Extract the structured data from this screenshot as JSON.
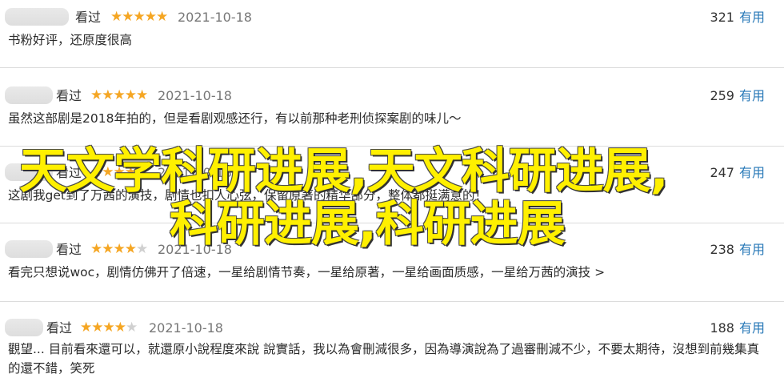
{
  "reviews": [
    {
      "status": "看过",
      "rating": 5,
      "date": "2021-10-18",
      "votes": "321",
      "useful_label": "有用",
      "text": "书粉好评，还原度很高"
    },
    {
      "status": "看过",
      "rating": 5,
      "date": "2021-10-18",
      "votes": "259",
      "useful_label": "有用",
      "text": "虽然这部剧是2018年拍的，但是看剧观感还行，有以前那种老刑侦探案剧的味儿～"
    },
    {
      "status": "看过",
      "rating": 4,
      "date": "2021-10-18",
      "votes": "247",
      "useful_label": "有用",
      "text": "这剧我get到了万茜的演技，剧情也扣人心弦，保留原著的精华部分，整体都挺满意的！"
    },
    {
      "status": "看过",
      "rating": 4,
      "date": "2021-10-18",
      "votes": "238",
      "useful_label": "有用",
      "text": "看完只想说woc，剧情仿佛开了倍速，一星给剧情节奏，一星给原著，一星给画面质感，一星给万茜的演技 >"
    },
    {
      "status": "看过",
      "rating": 4,
      "date": "2021-10-18",
      "votes": "188",
      "useful_label": "有用",
      "text": "觀望... 目前看來還可以，就還原小說程度來說 說實話，我以為會刪減很多，因為導演說為了過審刪減不少，不要太期待，沒想到前幾集真的還不錯，笑死"
    }
  ],
  "overlay": {
    "line1": "天文学科研进展,天文科研进展,",
    "line2": "科研进展,科研进展"
  },
  "colors": {
    "star_on": "#f5a623",
    "star_off": "#d0d0d0",
    "useful_link": "#2a7ab8",
    "overlay_text": "#fff000"
  },
  "icons": {
    "star": "star-icon"
  }
}
